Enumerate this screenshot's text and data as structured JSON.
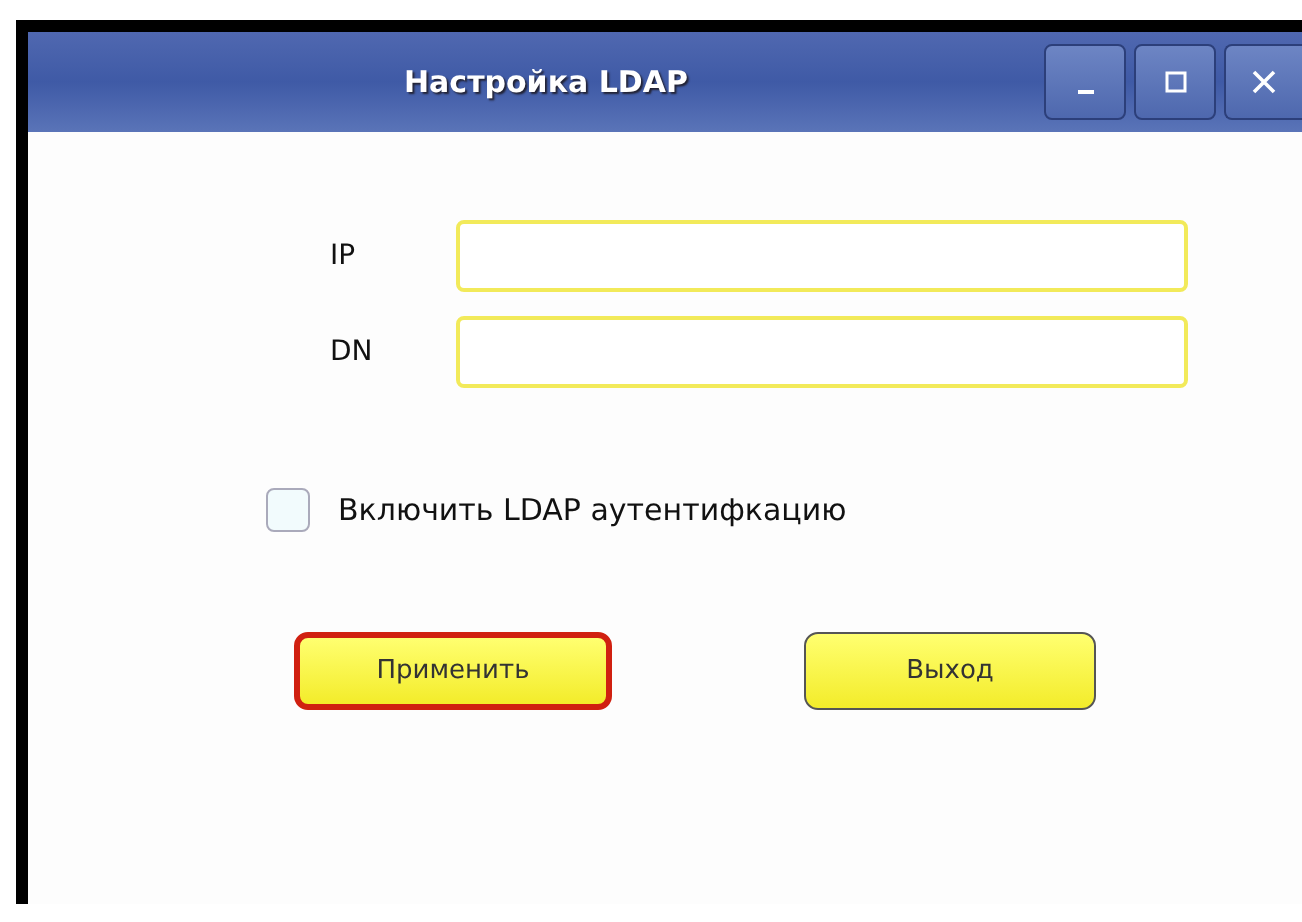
{
  "window": {
    "title": "Настройка LDAP"
  },
  "fields": [
    {
      "label": "IP"
    },
    {
      "label": "DN"
    }
  ],
  "checkbox": {
    "label": "Включить LDAP аутентифкацию",
    "checked": false
  },
  "buttons": [
    {
      "label": "Применить",
      "focused": true
    },
    {
      "label": "Выход",
      "focused": false
    }
  ]
}
